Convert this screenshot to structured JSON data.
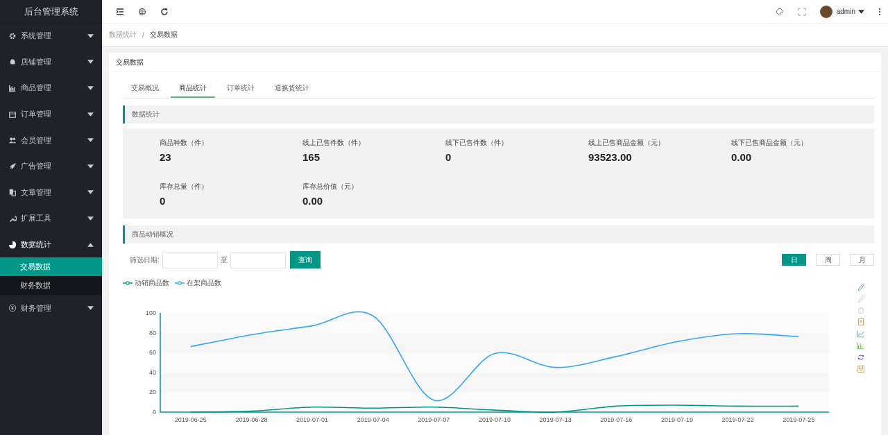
{
  "sidebar": {
    "title": "后台管理系统",
    "items": [
      {
        "label": "系统管理",
        "expanded": false
      },
      {
        "label": "店铺管理",
        "expanded": false
      },
      {
        "label": "商品管理",
        "expanded": false
      },
      {
        "label": "订单管理",
        "expanded": false
      },
      {
        "label": "会员管理",
        "expanded": false
      },
      {
        "label": "广告管理",
        "expanded": false
      },
      {
        "label": "文章管理",
        "expanded": false
      },
      {
        "label": "扩展工具",
        "expanded": false
      },
      {
        "label": "数据统计",
        "expanded": true,
        "children": [
          {
            "label": "交易数据",
            "selected": true
          },
          {
            "label": "财务数据",
            "selected": false
          }
        ]
      },
      {
        "label": "财务管理",
        "expanded": false
      }
    ]
  },
  "header": {
    "user": "admin"
  },
  "breadcrumb": {
    "items": [
      "数据统计",
      "交易数据"
    ],
    "separator": "/"
  },
  "card": {
    "title": "交易数据",
    "tabs": [
      {
        "label": "交易概况",
        "selected": false
      },
      {
        "label": "商品统计",
        "selected": true
      },
      {
        "label": "订单统计",
        "selected": false
      },
      {
        "label": "退换货统计",
        "selected": false
      }
    ],
    "stats_section": {
      "title": "数据统计",
      "stats": [
        {
          "label": "商品种数（件）",
          "value": "23"
        },
        {
          "label": "线上已售件数（件）",
          "value": "165"
        },
        {
          "label": "线下已售件数（件）",
          "value": "0"
        },
        {
          "label": "线上已售商品金额（元）",
          "value": "93523.00"
        },
        {
          "label": "线下已售商品金额（元）",
          "value": "0.00"
        },
        {
          "label": "库存总量（件）",
          "value": "0"
        },
        {
          "label": "库存总价值（元）",
          "value": "0.00"
        }
      ]
    },
    "sales_section": {
      "title": "商品动销概况",
      "filter": {
        "label": "筛选日期:",
        "separator": "至",
        "button": "查询"
      },
      "periods": [
        {
          "label": "日",
          "selected": true
        },
        {
          "label": "周",
          "selected": false
        },
        {
          "label": "月",
          "selected": false
        }
      ],
      "chart_data": {
        "type": "line",
        "categories": [
          "2019-06-25",
          "2019-06-28",
          "2019-07-01",
          "2019-07-04",
          "2019-07-07",
          "2019-07-10",
          "2019-07-13",
          "2019-07-16",
          "2019-07-19",
          "2019-07-22",
          "2019-07-25"
        ],
        "series": [
          {
            "name": "动销商品数",
            "color": "#009688",
            "values": [
              0,
              1,
              5,
              4,
              5,
              2,
              0,
              6,
              7,
              6,
              6
            ]
          },
          {
            "name": "在架商品数",
            "color": "#2ea7ff",
            "values": [
              66,
              78,
              87,
              97,
              12,
              59,
              45,
              56,
              71,
              79,
              76
            ]
          }
        ],
        "ylim": [
          0,
          100
        ],
        "yticks": [
          0,
          20,
          40,
          60,
          80,
          100
        ]
      }
    }
  }
}
